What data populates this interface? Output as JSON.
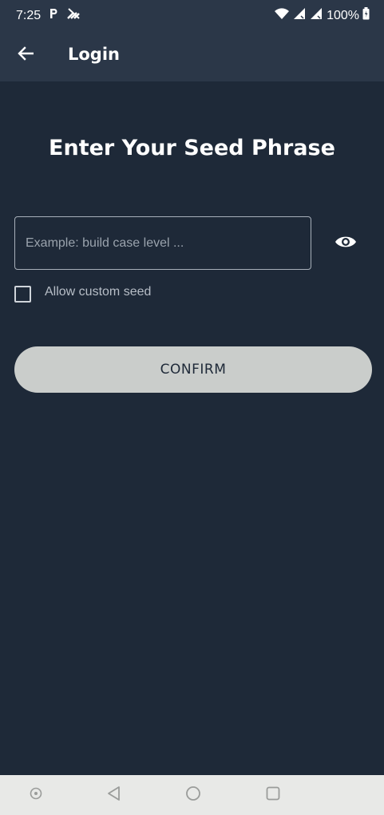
{
  "status_bar": {
    "time": "7:25",
    "battery": "100%",
    "icons": [
      "parking-icon",
      "signal-off-icon",
      "wifi-icon",
      "cell-signal-icon",
      "battery-icon"
    ]
  },
  "app_bar": {
    "title": "Login",
    "back_icon": "arrow-back-icon"
  },
  "main": {
    "heading": "Enter Your Seed Phrase",
    "seed_input": {
      "value": "",
      "placeholder": "Example: build case level ..."
    },
    "visibility_icon": "eye-icon",
    "custom_seed": {
      "label": "Allow custom seed",
      "checked": false
    },
    "confirm_label": "CONFIRM"
  },
  "nav_bar": {
    "items": [
      "assistant-icon",
      "back-icon",
      "home-icon",
      "recents-icon"
    ]
  },
  "colors": {
    "background": "#1e2938",
    "app_bar": "#2b3748",
    "button_fill": "#cacdcb",
    "nav_bar": "#e8e9e7"
  }
}
